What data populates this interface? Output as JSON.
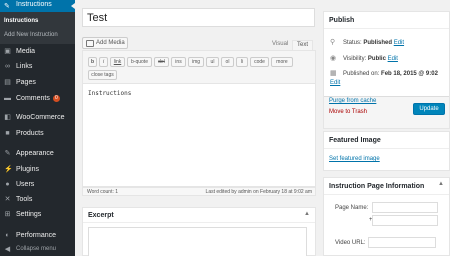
{
  "sidebar": {
    "current_menu": "Instructions",
    "submenu": [
      "Instructions",
      "Add New Instruction"
    ],
    "items": [
      {
        "label": "Media",
        "icon": "media-icon"
      },
      {
        "label": "Links",
        "icon": "links-icon"
      },
      {
        "label": "Pages",
        "icon": "pages-icon"
      },
      {
        "label": "Comments",
        "icon": "comments-icon",
        "badge": "0"
      },
      {
        "label": "WooCommerce",
        "icon": "woocommerce-icon"
      },
      {
        "label": "Products",
        "icon": "products-icon"
      },
      {
        "label": "Appearance",
        "icon": "appearance-icon"
      },
      {
        "label": "Plugins",
        "icon": "plugins-icon"
      },
      {
        "label": "Users",
        "icon": "users-icon"
      },
      {
        "label": "Tools",
        "icon": "tools-icon"
      },
      {
        "label": "Settings",
        "icon": "settings-icon"
      },
      {
        "label": "Performance",
        "icon": "performance-icon"
      },
      {
        "label": "Collapse menu",
        "icon": "collapse-icon"
      }
    ]
  },
  "post": {
    "title": "Test"
  },
  "editor": {
    "add_media": "Add Media",
    "tabs": [
      "Visual",
      "Text"
    ],
    "toolbar_buttons": [
      "b",
      "i",
      "link",
      "b-quote",
      "del",
      "ins",
      "img",
      "ul",
      "ol",
      "li",
      "code",
      "more",
      "close tags"
    ],
    "content": "Instructions",
    "word_count": "Word count: 1",
    "last_edited": "Last edited by admin on February 18 at 9:02 am"
  },
  "excerpt": {
    "title": "Excerpt"
  },
  "publish": {
    "title": "Publish",
    "status_label": "Status:",
    "status_value": "Published",
    "visibility_label": "Visibility:",
    "visibility_value": "Public",
    "published_on_label": "Published on:",
    "published_on_value": "Feb 18, 2015 @ 9:02",
    "edit": "Edit",
    "purge": "Purge from cache",
    "trash": "Move to Trash",
    "update": "Update"
  },
  "featured_image": {
    "title": "Featured Image",
    "link": "Set featured image"
  },
  "instruction_info": {
    "title": "Instruction Page Information",
    "page_name_label": "Page Name:",
    "plus": "+",
    "video_url_label": "Video URL:"
  },
  "colors": {
    "sidebar_bg": "#23282d",
    "accent": "#0073aa",
    "button_primary": "#0085ba",
    "badge": "#d54e21",
    "trash": "#a00000"
  }
}
